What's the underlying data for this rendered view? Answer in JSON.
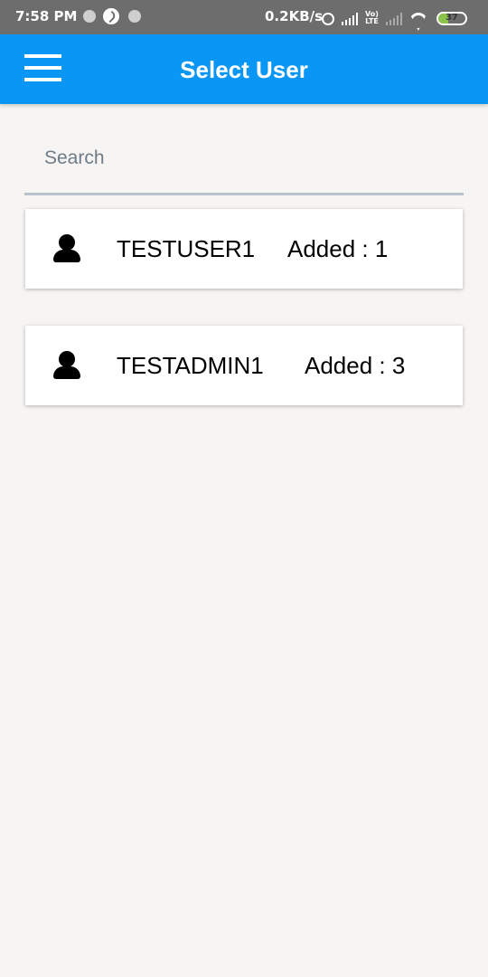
{
  "status_bar": {
    "time": "7:58 PM",
    "net_speed": "0.2KB/s",
    "volte": "Vo)) LTE",
    "battery": "37",
    "battery_level": 0.37
  },
  "app_bar": {
    "title": "Select User"
  },
  "search": {
    "placeholder": "Search",
    "value": ""
  },
  "users": [
    {
      "name": "TESTUSER1",
      "added": "Added : 1"
    },
    {
      "name": "TESTADMIN1",
      "added": "Added : 3"
    }
  ],
  "colors": {
    "app_bar": "#0a96f5",
    "status_bar": "#6d6d6d",
    "background": "#f6f5f3",
    "battery_fill": "#8bc34a"
  }
}
